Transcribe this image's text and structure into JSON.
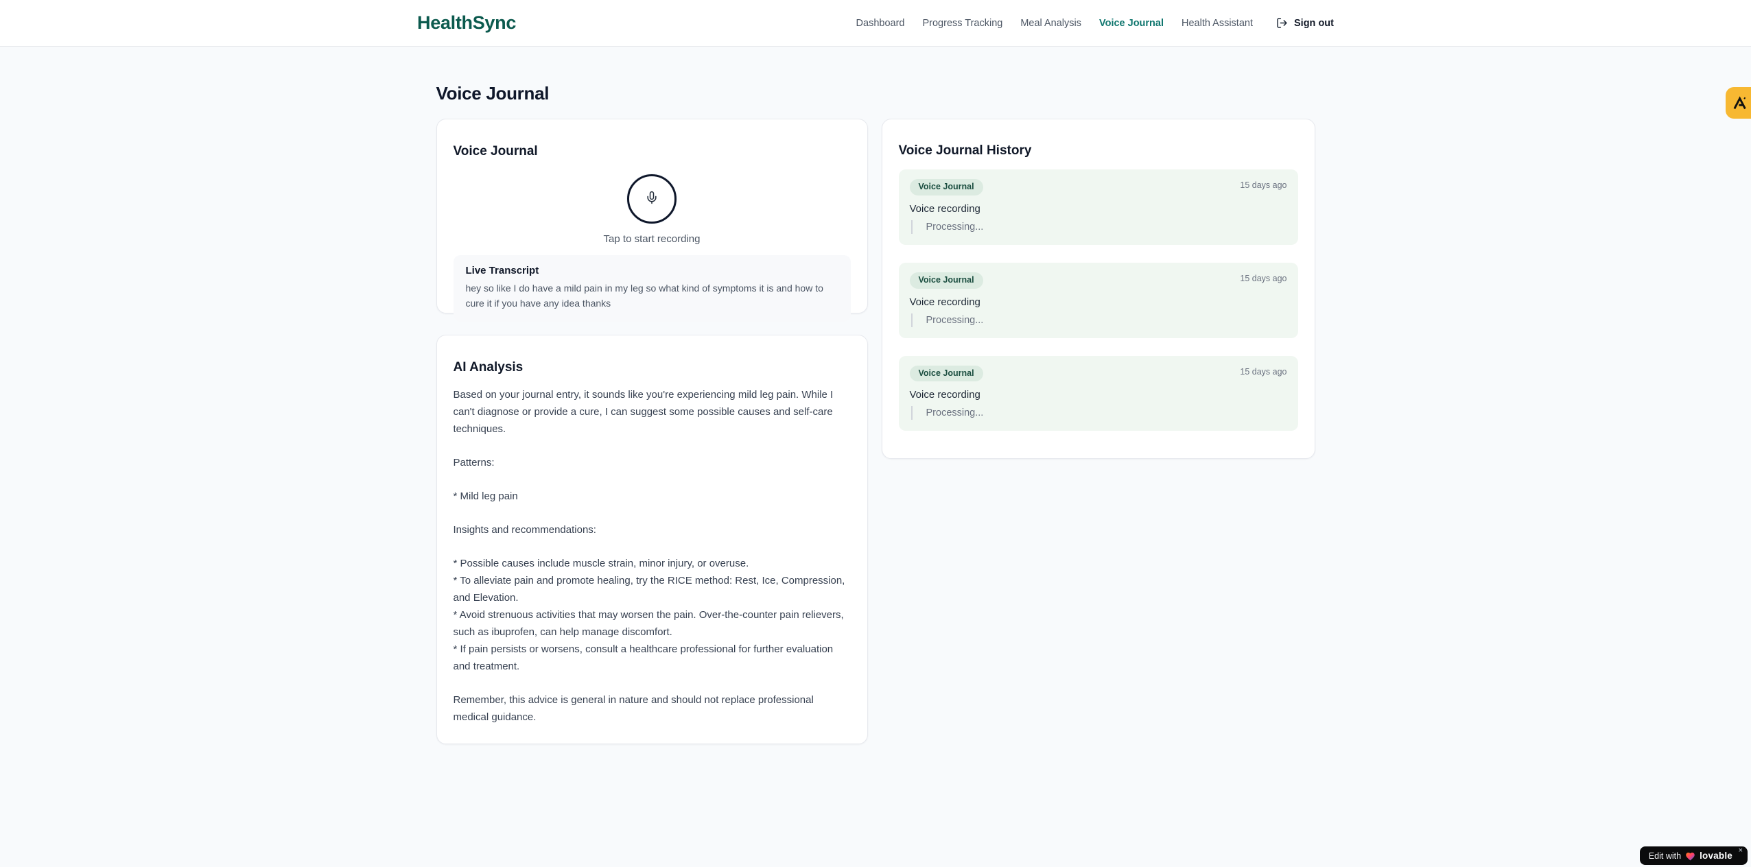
{
  "header": {
    "brand": "HealthSync",
    "nav_items": [
      {
        "label": "Dashboard"
      },
      {
        "label": "Progress Tracking"
      },
      {
        "label": "Meal Analysis"
      },
      {
        "label": "Voice Journal"
      },
      {
        "label": "Health Assistant"
      }
    ],
    "sign_out_label": "Sign out"
  },
  "page": {
    "title": "Voice Journal"
  },
  "recorder": {
    "card_title": "Voice Journal",
    "hint": "Tap to start recording",
    "transcript_label": "Live Transcript",
    "transcript_text": "hey so like I do have a mild pain in my leg so what kind of symptoms it is and how to cure it if you have any idea thanks"
  },
  "analysis": {
    "card_title": "AI Analysis",
    "paragraphs": [
      "Based on your journal entry, it sounds like you're experiencing mild leg pain. While I can't diagnose or provide a cure, I can suggest some possible causes and self-care techniques.",
      "Patterns:",
      "* Mild leg pain",
      "Insights and recommendations:",
      "* Possible causes include muscle strain, minor injury, or overuse.\n* To alleviate pain and promote healing, try the RICE method: Rest, Ice, Compression, and Elevation.\n* Avoid strenuous activities that may worsen the pain. Over-the-counter pain relievers, such as ibuprofen, can help manage discomfort.\n* If pain persists or worsens, consult a healthcare professional for further evaluation and treatment.",
      "Remember, this advice is general in nature and should not replace professional medical guidance."
    ]
  },
  "history": {
    "title": "Voice Journal History",
    "entries": [
      {
        "badge": "Voice Journal",
        "time": "15 days ago",
        "label": "Voice recording",
        "status": "Processing..."
      },
      {
        "badge": "Voice Journal",
        "time": "15 days ago",
        "label": "Voice recording",
        "status": "Processing..."
      },
      {
        "badge": "Voice Journal",
        "time": "15 days ago",
        "label": "Voice recording",
        "status": "Processing..."
      }
    ]
  },
  "overlays": {
    "edit_badge": {
      "prefix": "Edit with",
      "brand": "lovable",
      "close": "×"
    }
  },
  "colors": {
    "brand_teal": "#0c5a4e",
    "nav_active": "#0f766e",
    "history_entry_bg": "#f0f7f1",
    "badge_bg": "#dcebe1",
    "badge_text": "#1c4f41",
    "amber_badge": "#f7b832",
    "page_bg": "#f8fafc"
  }
}
